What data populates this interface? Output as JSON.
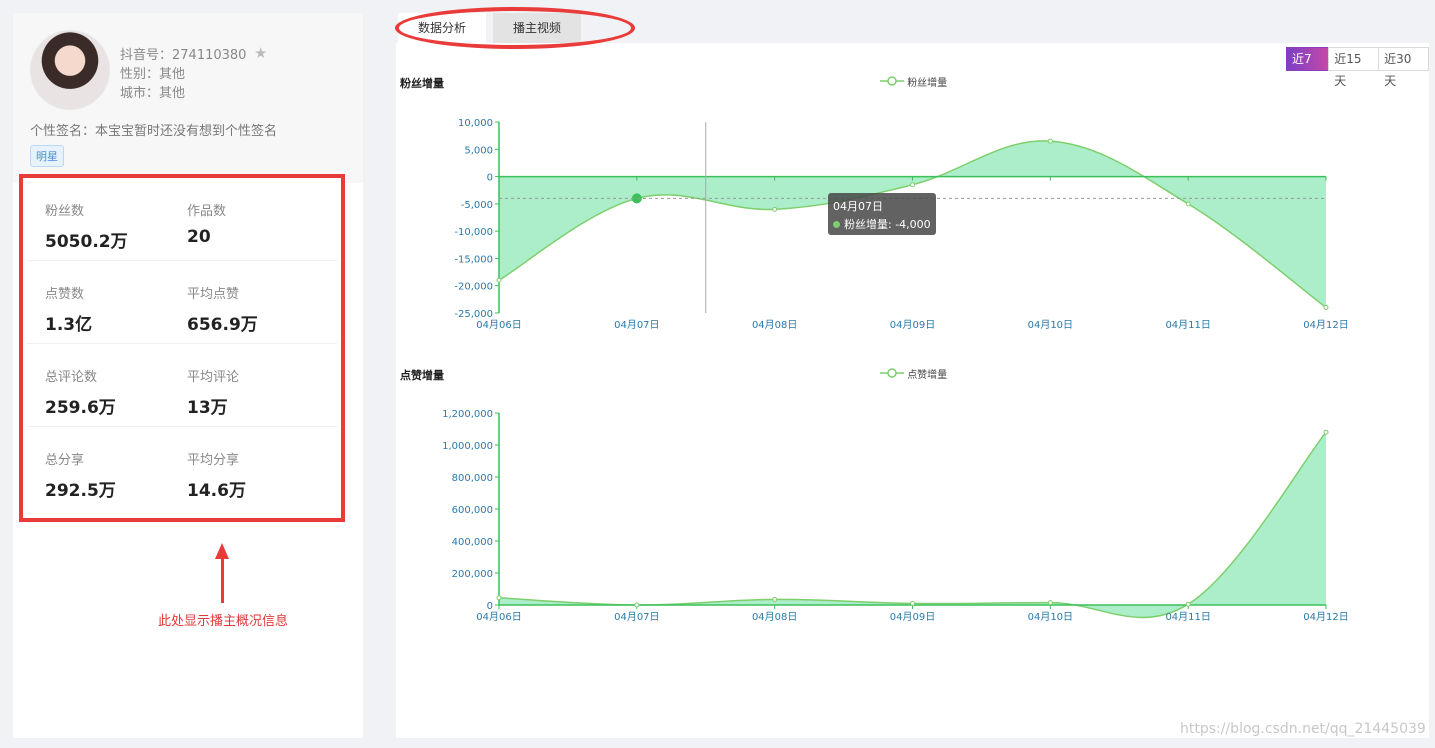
{
  "profile": {
    "douyin_id": "抖音号：274110380",
    "gender": "性别：其他",
    "city": "城市：其他",
    "signature": "个性签名：本宝宝暂时还没有想到个性签名",
    "tag": "明星"
  },
  "stats": [
    {
      "label": "粉丝数",
      "value": "5050.2万"
    },
    {
      "label": "作品数",
      "value": "20"
    },
    {
      "label": "点赞数",
      "value": "1.3亿"
    },
    {
      "label": "平均点赞",
      "value": "656.9万"
    },
    {
      "label": "总评论数",
      "value": "259.6万"
    },
    {
      "label": "平均评论",
      "value": "13万"
    },
    {
      "label": "总分享",
      "value": "292.5万"
    },
    {
      "label": "平均分享",
      "value": "14.6万"
    }
  ],
  "annotation": "此处显示播主概况信息",
  "tabs": [
    {
      "label": "数据分析"
    },
    {
      "label": "播主视频"
    }
  ],
  "range_buttons": [
    "近7天",
    "近15天",
    "近30天"
  ],
  "colors": {
    "accent_red": "#ea3b3b",
    "series_line": "#7ccf6c",
    "series_fill": "#a8ecc7",
    "axis": "#3cc05a",
    "tick_text": "#2a7aa8"
  },
  "chart_data": [
    {
      "type": "area",
      "title": "粉丝增量",
      "legend": "粉丝增量",
      "legend_position": "top-center",
      "x": [
        "04月06日",
        "04月07日",
        "04月08日",
        "04月09日",
        "04月10日",
        "04月11日",
        "04月12日"
      ],
      "series": [
        {
          "name": "粉丝增量",
          "values": [
            -19000,
            -4000,
            -6000,
            -1500,
            6500,
            -5000,
            -24000
          ]
        }
      ],
      "ylim": [
        -25000,
        10000
      ],
      "yticks": [
        "10,000",
        "5,000",
        "0",
        "-5,000",
        "-10,000",
        "-15,000",
        "-20,000",
        "-25,000"
      ],
      "ytick_values": [
        10000,
        5000,
        0,
        -5000,
        -10000,
        -15000,
        -20000,
        -25000
      ],
      "tooltip": {
        "date": "04月07日",
        "label": "粉丝增量: -4,000"
      }
    },
    {
      "type": "area",
      "title": "点赞增量",
      "legend": "点赞增量",
      "legend_position": "top-center",
      "x": [
        "04月06日",
        "04月07日",
        "04月08日",
        "04月09日",
        "04月10日",
        "04月11日",
        "04月12日"
      ],
      "series": [
        {
          "name": "点赞增量",
          "values": [
            45000,
            0,
            35000,
            10000,
            15000,
            5000,
            1080000
          ]
        }
      ],
      "ylim": [
        0,
        1200000
      ],
      "yticks": [
        "1,200,000",
        "1,000,000",
        "800,000",
        "600,000",
        "400,000",
        "200,000",
        "0"
      ],
      "ytick_values": [
        1200000,
        1000000,
        800000,
        600000,
        400000,
        200000,
        0
      ]
    }
  ],
  "watermark": "https://blog.csdn.net/qq_21445039"
}
